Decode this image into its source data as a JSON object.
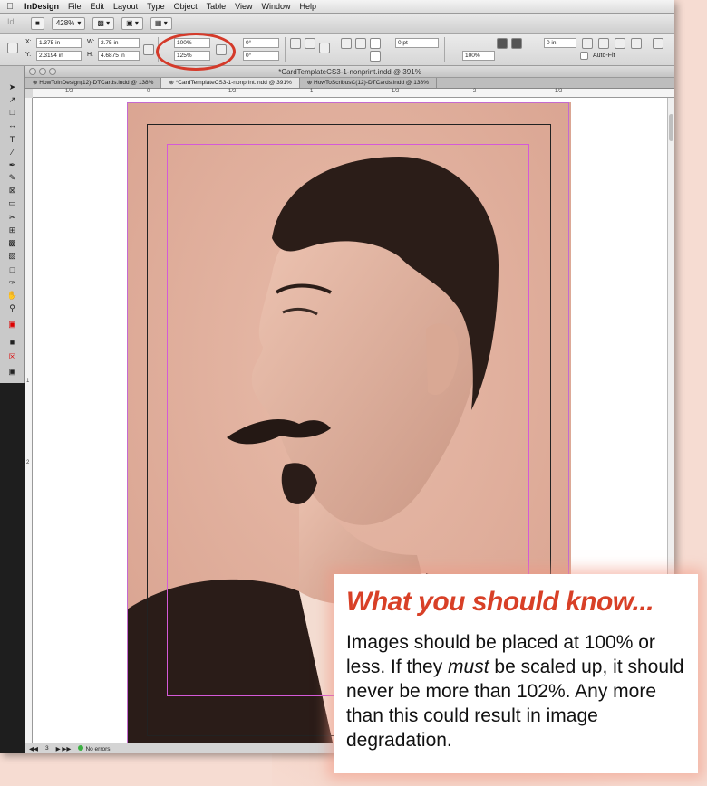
{
  "menubar": {
    "app_name": "InDesign",
    "items": [
      "File",
      "Edit",
      "Layout",
      "Type",
      "Object",
      "Table",
      "View",
      "Window",
      "Help"
    ]
  },
  "appbar": {
    "zoom": "428%"
  },
  "controls": {
    "x": "1.375 in",
    "y": "2.3194 in",
    "w": "2.75 in",
    "h": "4.6875 in",
    "scale_x": "100%",
    "scale_y": "125%",
    "rotate": "0°",
    "shear": "0°",
    "stroke": "0 pt",
    "opacity": "100%",
    "inset": "0 in",
    "autofit": "Auto-Fit"
  },
  "document": {
    "title": "*CardTemplateCS3-1-nonprint.indd @ 391%",
    "tabs": [
      "HowToInDesign(12)-DTCards.indd @ 138%",
      "*CardTemplateCS3-1-nonprint.indd @ 391%",
      "HowToScribusC(12)-DTCards.indd @ 138%"
    ],
    "ruler_h": [
      "1/2",
      "0",
      "1/2",
      "1",
      "1/2",
      "2",
      "1/2"
    ],
    "ruler_v": [
      "1",
      "2"
    ]
  },
  "status": {
    "page": "3",
    "errors": "No errors"
  },
  "callout": {
    "title": "What you should know...",
    "text_before": "Images should be placed at 100% or less. If they ",
    "emphasis": "must",
    "text_after": " be scaled up, it should never be more than 102%. Any more than this could result in image degradation."
  },
  "colors": {
    "accent": "#d84027",
    "highlight_ring": "#d43a2a",
    "page_bg": "#e3b1a0"
  }
}
